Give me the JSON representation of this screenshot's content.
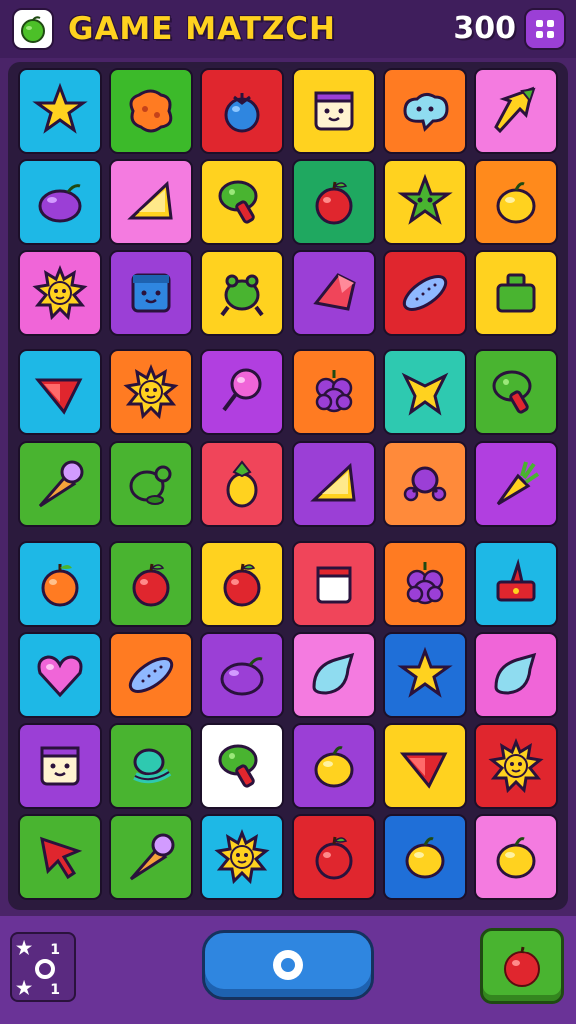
{
  "header": {
    "title": "GAME MATZCH",
    "score": "300",
    "app_icon": "green-apple-icon",
    "menu_icon": "grid-menu-icon"
  },
  "board": {
    "rows": [
      [
        {
          "bg": "#1eb8e6",
          "icon": "star"
        },
        {
          "bg": "#3cba2a",
          "icon": "splat"
        },
        {
          "bg": "#e0262e",
          "icon": "berry"
        },
        {
          "bg": "#ffd21f",
          "icon": "box-face"
        },
        {
          "bg": "#ff7b22",
          "icon": "cloud-face"
        },
        {
          "bg": "#f47be0",
          "icon": "arrow"
        }
      ],
      [
        {
          "bg": "#1eb8e6",
          "icon": "plum"
        },
        {
          "bg": "#f47be0",
          "icon": "wedge"
        },
        {
          "bg": "#ffd21f",
          "icon": "mushroom"
        },
        {
          "bg": "#1fa860",
          "icon": "apple"
        },
        {
          "bg": "#ffd21f",
          "icon": "star-face"
        },
        {
          "bg": "#ff8a1c",
          "icon": "lemon"
        }
      ],
      [
        {
          "bg": "#f065d8",
          "icon": "sun-face"
        },
        {
          "bg": "#9b3fd6",
          "icon": "cube-face"
        },
        {
          "bg": "#ffd21f",
          "icon": "frog"
        },
        {
          "bg": "#9b3fd6",
          "icon": "gem"
        },
        {
          "bg": "#e0262e",
          "icon": "leaf-pod"
        },
        {
          "bg": "#ffd21f",
          "icon": "basket"
        }
      ],
      [
        {
          "bg": "#1eb8e6",
          "icon": "triangle-gem"
        },
        {
          "bg": "#ff7b22",
          "icon": "sun-face"
        },
        {
          "bg": "#b13fe0",
          "icon": "lollipop"
        },
        {
          "bg": "#ff7b22",
          "icon": "grapes"
        },
        {
          "bg": "#2ec9b0",
          "icon": "star-fruit"
        },
        {
          "bg": "#49b430",
          "icon": "mushroom"
        }
      ],
      [
        {
          "bg": "#49b430",
          "icon": "ice-cream"
        },
        {
          "bg": "#49b430",
          "icon": "acorn"
        },
        {
          "bg": "#f0455a",
          "icon": "pineapple"
        },
        {
          "bg": "#9b3fd6",
          "icon": "wedge"
        },
        {
          "bg": "#ff8a3a",
          "icon": "berry-bundle"
        },
        {
          "bg": "#b13fe0",
          "icon": "carrot"
        }
      ],
      [
        {
          "bg": "#1eb8e6",
          "icon": "orange"
        },
        {
          "bg": "#49b430",
          "icon": "apple"
        },
        {
          "bg": "#ffd21f",
          "icon": "apple"
        },
        {
          "bg": "#f0455a",
          "icon": "jar"
        },
        {
          "bg": "#ff7b22",
          "icon": "grapes"
        },
        {
          "bg": "#1eb8e6",
          "icon": "cake"
        }
      ],
      [
        {
          "bg": "#1eb8e6",
          "icon": "heart"
        },
        {
          "bg": "#ff7b22",
          "icon": "leaf-pod"
        },
        {
          "bg": "#9b3fd6",
          "icon": "plum"
        },
        {
          "bg": "#f47be0",
          "icon": "drop"
        },
        {
          "bg": "#1f6fd8",
          "icon": "star"
        },
        {
          "bg": "#f065d8",
          "icon": "drop"
        }
      ],
      [
        {
          "bg": "#9b3fd6",
          "icon": "box-face"
        },
        {
          "bg": "#49b430",
          "icon": "ring"
        },
        {
          "bg": "#ffffff",
          "icon": "mushroom"
        },
        {
          "bg": "#9b3fd6",
          "icon": "lemon"
        },
        {
          "bg": "#ffd21f",
          "icon": "triangle-gem"
        },
        {
          "bg": "#e0262e",
          "icon": "sun-face"
        }
      ],
      [
        {
          "bg": "#49b430",
          "icon": "arrow-red"
        },
        {
          "bg": "#49b430",
          "icon": "ice-cream"
        },
        {
          "bg": "#1eb8e6",
          "icon": "sun-face"
        },
        {
          "bg": "#e0262e",
          "icon": "apple"
        },
        {
          "bg": "#1f6fd8",
          "icon": "lemon"
        },
        {
          "bg": "#f47be0",
          "icon": "lemon"
        }
      ]
    ]
  },
  "bottom": {
    "stat_top": "1",
    "stat_bottom": "1",
    "stat_star_icon": "star-icon",
    "play_icon": "circle-icon",
    "hint_icon": "red-apple-icon"
  }
}
